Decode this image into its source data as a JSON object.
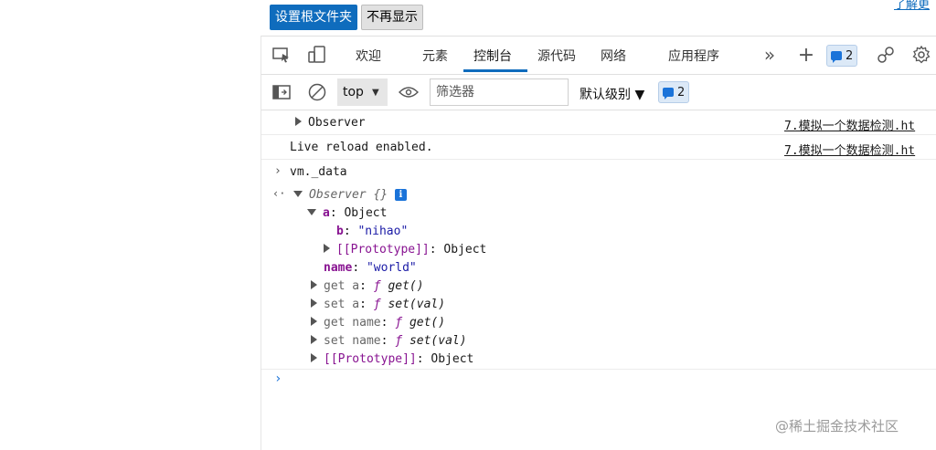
{
  "top_buttons": {
    "set_root": "设置根文件夹",
    "dont_show": "不再显示"
  },
  "learn_more": "了解更",
  "tabs": [
    "欢迎",
    "元素",
    "控制台",
    "源代码",
    "网络",
    "应用程序"
  ],
  "active_tab": "控制台",
  "tab_badge_count": "2",
  "toolbar": {
    "context": "top",
    "filter_placeholder": "筛选器",
    "levels": "默认级别 ▼",
    "badge_count": "2"
  },
  "console": {
    "messages": [
      {
        "text": "Observer",
        "source": "7.模拟一个数据检测.ht"
      },
      {
        "text": "Live reload enabled.",
        "source": "7.模拟一个数据检测.ht"
      }
    ],
    "input": "vm._data",
    "result": {
      "title": "Observer {}",
      "a_key": "a",
      "a_val": "Object",
      "b_key": "b",
      "b_val": "\"nihao\"",
      "proto1_key": "[[Prototype]]",
      "proto1_val": "Object",
      "name_key": "name",
      "name_val": "\"world\"",
      "get_a_key": "get a",
      "get_a_val": "get()",
      "set_a_key": "set a",
      "set_a_val": "set(val)",
      "get_name_key": "get name",
      "get_name_val": "get()",
      "set_name_key": "set name",
      "set_name_val": "set(val)",
      "proto2_key": "[[Prototype]]",
      "proto2_val": "Object",
      "func_symbol": "ƒ"
    }
  },
  "watermark": "@稀土掘金技术社区"
}
